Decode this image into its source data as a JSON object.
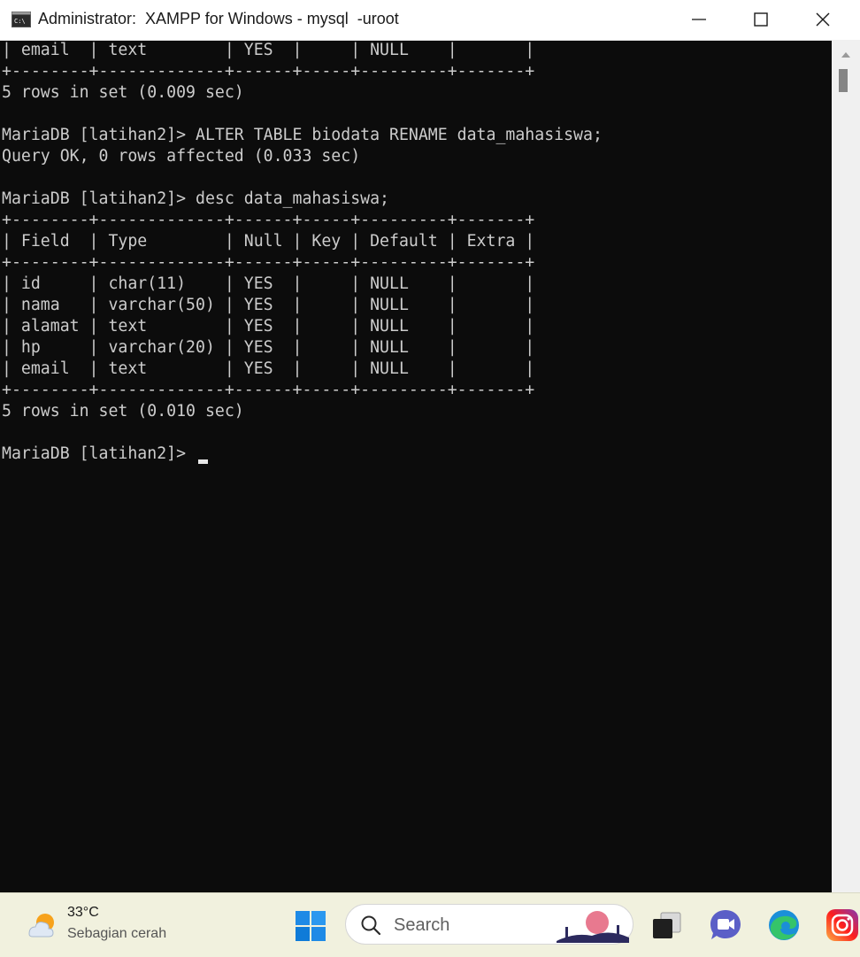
{
  "window": {
    "title": "Administrator:  XAMPP for Windows - mysql  -uroot",
    "buttons": {
      "minimize": "minimize",
      "maximize": "maximize",
      "close": "close"
    }
  },
  "console": {
    "lines": [
      "| email  | text        | YES  |     | NULL    |       |",
      "+--------+-------------+------+-----+---------+-------+",
      "5 rows in set (0.009 sec)",
      "",
      "MariaDB [latihan2]> ALTER TABLE biodata RENAME data_mahasiswa;",
      "Query OK, 0 rows affected (0.033 sec)",
      "",
      "MariaDB [latihan2]> desc data_mahasiswa;",
      "+--------+-------------+------+-----+---------+-------+",
      "| Field  | Type        | Null | Key | Default | Extra |",
      "+--------+-------------+------+-----+---------+-------+",
      "| id     | char(11)    | YES  |     | NULL    |       |",
      "| nama   | varchar(50) | YES  |     | NULL    |       |",
      "| alamat | text        | YES  |     | NULL    |       |",
      "| hp     | varchar(20) | YES  |     | NULL    |       |",
      "| email  | text        | YES  |     | NULL    |       |",
      "+--------+-------------+------+-----+---------+-------+",
      "5 rows in set (0.010 sec)",
      "",
      "MariaDB [latihan2]> "
    ]
  },
  "taskbar": {
    "weather": {
      "temperature": "33°C",
      "condition": "Sebagian cerah"
    },
    "search": {
      "placeholder": "Search"
    },
    "apps": [
      "task-view",
      "teams",
      "edge",
      "instagram"
    ]
  }
}
